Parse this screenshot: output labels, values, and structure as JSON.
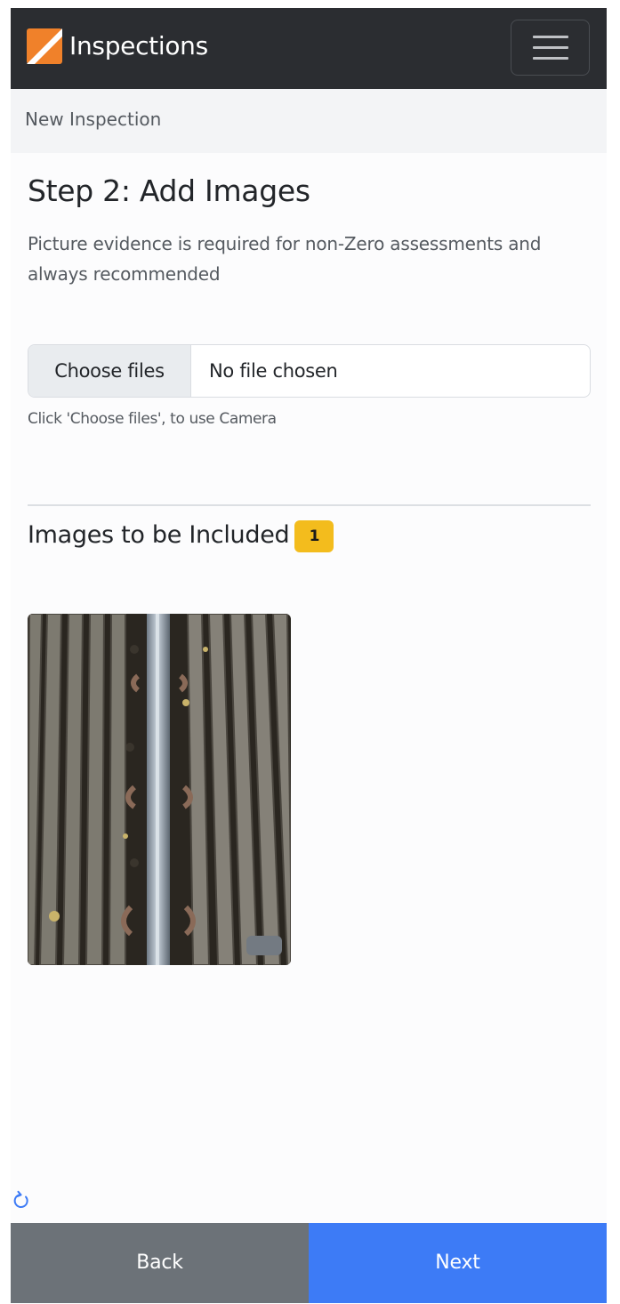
{
  "navbar": {
    "title": "Inspections",
    "logo_icon": "brand-logo-icon",
    "menu_icon": "hamburger-menu-icon"
  },
  "breadcrumb": {
    "current": "New Inspection"
  },
  "step": {
    "title": "Step 2: Add Images",
    "description": "Picture evidence is required for non-Zero assessments and always recommended"
  },
  "file_input": {
    "button_label": "Choose files",
    "status": "No file chosen",
    "hint": "Click 'Choose files', to use Camera"
  },
  "images": {
    "heading": "Images to be Included",
    "count": "1"
  },
  "footer": {
    "back_label": "Back",
    "next_label": "Next"
  },
  "colors": {
    "navbar_bg": "#2b2d31",
    "brand_accent": "#f0812a",
    "badge": "#f3bc1d",
    "next_button": "#3d7bf6",
    "back_button": "#6c7278"
  }
}
